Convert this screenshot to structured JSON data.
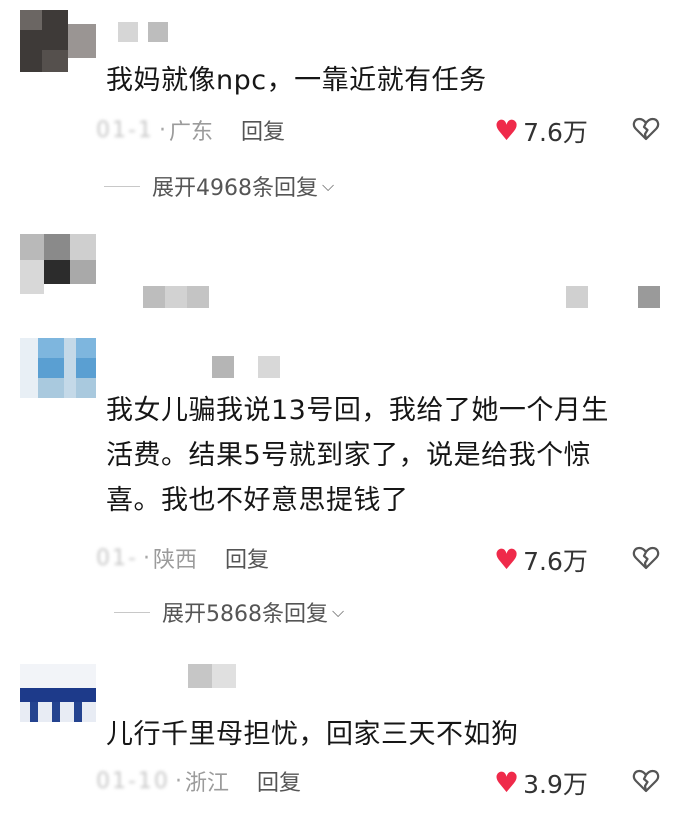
{
  "colors": {
    "like_heart": "#ef2a4a",
    "text_primary": "#161616",
    "text_meta": "#8d8d8d"
  },
  "icons": {
    "like": "heart-icon",
    "dislike": "broken-heart-icon",
    "expand": "chevron-down-icon"
  },
  "comments": [
    {
      "lines": [
        "我妈就像npc，一靠近就有任务"
      ],
      "date_blur": "01-1",
      "region": "广东",
      "reply_label": "回复",
      "likes": "7.6万",
      "expand_label": "展开4968条回复"
    },
    {
      "lines": [
        "我女儿骗我说13号回，我给了她一个月生",
        "活费。结果5号就到家了，说是给我个惊",
        "喜。我也不好意思提钱了"
      ],
      "date_blur": "01-",
      "region": "陕西",
      "reply_label": "回复",
      "likes": "7.6万",
      "expand_label": "展开5868条回复"
    },
    {
      "lines": [
        "儿行千里母担忧，回家三天不如狗"
      ],
      "date_blur": "01-10",
      "region": "浙江",
      "reply_label": "回复",
      "likes": "3.9万"
    }
  ]
}
